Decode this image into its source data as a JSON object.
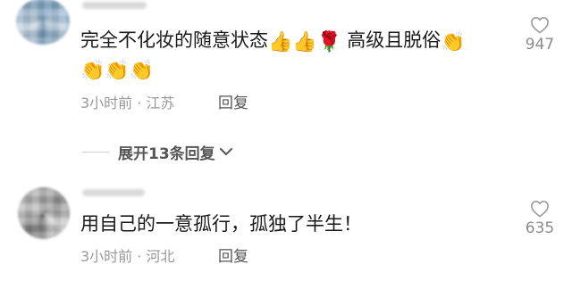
{
  "comments": [
    {
      "text_before": "完全不化妆的随意状态",
      "emojis_line1": [
        "👍",
        "👍",
        "🌹"
      ],
      "text_after": "高级且脱俗",
      "emojis_trailing": [
        "👏"
      ],
      "emojis_line2": [
        "👏",
        "👏",
        "👏"
      ],
      "time": "3小时前",
      "separator": "·",
      "location": "江苏",
      "reply_label": "回复",
      "likes": "947"
    },
    {
      "text": "用自己的一意孤行，孤独了半生！",
      "time": "3小时前",
      "separator": "·",
      "location": "河北",
      "reply_label": "回复",
      "likes": "635"
    }
  ],
  "expand_replies": {
    "label": "展开13条回复",
    "icon": "chevron-down-icon"
  },
  "icons": {
    "like": "heart-outline-icon",
    "emoji_thumbs": "thumbs-up-icon",
    "emoji_rose": "rose-icon",
    "emoji_clap": "clapping-hands-icon"
  }
}
